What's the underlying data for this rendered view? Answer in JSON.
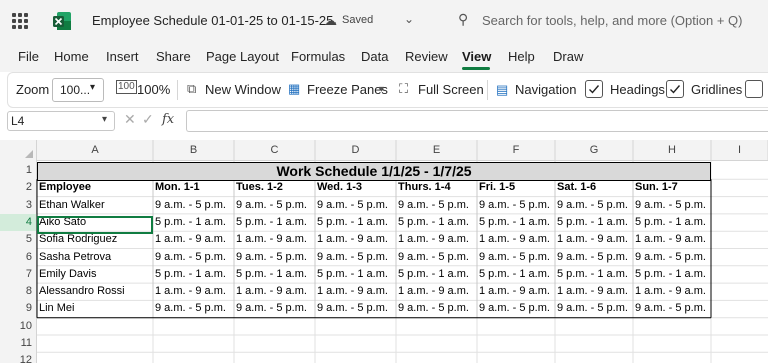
{
  "titlebar": {
    "doc_title": "Employee Schedule 01-01-25 to 01-15-25",
    "status": "Saved",
    "search_placeholder": "Search for tools, help, and more (Option + Q)"
  },
  "menu": {
    "items": [
      "File",
      "Home",
      "Insert",
      "Share",
      "Page Layout",
      "Formulas",
      "Data",
      "Review",
      "View",
      "Help",
      "Draw"
    ],
    "active": "View"
  },
  "ribbon": {
    "zoom_label": "Zoom",
    "zoom_value": "100...",
    "zoom_100": "100%",
    "new_window": "New Window",
    "freeze_panes": "Freeze Panes",
    "full_screen": "Full Screen",
    "navigation": "Navigation",
    "headings": "Headings",
    "gridlines": "Gridlines",
    "headings_checked": true,
    "gridlines_checked": true
  },
  "formula_bar": {
    "name_box": "L4",
    "formula": ""
  },
  "sheet": {
    "columns": [
      "A",
      "B",
      "C",
      "D",
      "E",
      "F",
      "G",
      "H",
      "I"
    ],
    "rows": [
      "1",
      "2",
      "3",
      "4",
      "5",
      "6",
      "7",
      "8",
      "9",
      "10",
      "11",
      "12"
    ],
    "selected_row": "4",
    "title": "Work Schedule 1/1/25 - 1/7/25",
    "header": [
      "Employee",
      "Mon. 1-1",
      "Tues. 1-2",
      "Wed. 1-3",
      "Thurs. 1-4",
      "Fri. 1-5",
      "Sat. 1-6",
      "Sun. 1-7"
    ],
    "data": [
      [
        "Ethan Walker",
        "9 a.m. - 5 p.m.",
        "9 a.m. - 5 p.m.",
        "9 a.m. - 5 p.m.",
        "9 a.m. - 5 p.m.",
        "9 a.m. - 5 p.m.",
        "9 a.m. - 5 p.m.",
        "9 a.m. - 5 p.m."
      ],
      [
        "Aiko Sato",
        "5 p.m. - 1 a.m.",
        "5 p.m. - 1 a.m.",
        "5 p.m. - 1 a.m.",
        "5 p.m. - 1 a.m.",
        "5 p.m. - 1 a.m.",
        "5 p.m. - 1 a.m.",
        "5 p.m. - 1 a.m."
      ],
      [
        "Sofia Rodriguez",
        "1 a.m. - 9 a.m.",
        "1 a.m. - 9 a.m.",
        "1 a.m. - 9 a.m.",
        "1 a.m. - 9 a.m.",
        "1 a.m. - 9 a.m.",
        "1 a.m. - 9 a.m.",
        "1 a.m. - 9 a.m."
      ],
      [
        "Sasha Petrova",
        "9 a.m. - 5 p.m.",
        "9 a.m. - 5 p.m.",
        "9 a.m. - 5 p.m.",
        "9 a.m. - 5 p.m.",
        "9 a.m. - 5 p.m.",
        "9 a.m. - 5 p.m.",
        "9 a.m. - 5 p.m."
      ],
      [
        "Emily Davis",
        "5 p.m. - 1 a.m.",
        "5 p.m. - 1 a.m.",
        "5 p.m. - 1 a.m.",
        "5 p.m. - 1 a.m.",
        "5 p.m. - 1 a.m.",
        "5 p.m. - 1 a.m.",
        "5 p.m. - 1 a.m."
      ],
      [
        "Alessandro Rossi",
        "1 a.m. - 9 a.m.",
        "1 a.m. - 9 a.m.",
        "1 a.m. - 9 a.m.",
        "1 a.m. - 9 a.m.",
        "1 a.m. - 9 a.m.",
        "1 a.m. - 9 a.m.",
        "1 a.m. - 9 a.m."
      ],
      [
        "Lin Mei",
        "9 a.m. - 5 p.m.",
        "9 a.m. - 5 p.m.",
        "9 a.m. - 5 p.m.",
        "9 a.m. - 5 p.m.",
        "9 a.m. - 5 p.m.",
        "9 a.m. - 5 p.m.",
        "9 a.m. - 5 p.m."
      ]
    ]
  },
  "colors": {
    "accent": "#107c41",
    "chrome": "#f3f3f3",
    "title_band": "#d9d9d9"
  },
  "icons": [
    "app-launcher-icon",
    "excel-logo-icon",
    "cloud-saved-icon",
    "chevron-down-icon",
    "search-icon",
    "zoom-100-icon",
    "new-window-icon",
    "freeze-panes-icon",
    "full-screen-icon",
    "navigation-icon",
    "checkbox-checked-icon",
    "cancel-icon",
    "enter-icon",
    "function-icon"
  ]
}
